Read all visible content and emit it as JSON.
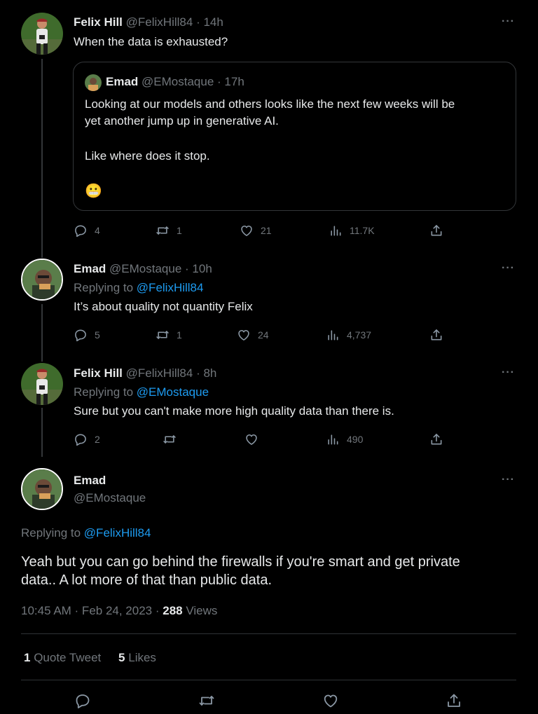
{
  "tweet1": {
    "name": "Felix Hill",
    "handle": "@FelixHill84",
    "time": "· 14h",
    "more": "···",
    "text": "When the data is exhausted?",
    "quote": {
      "name": "Emad",
      "handle": "@EMostaque",
      "time": "· 17h",
      "line1": "Looking at our models and others looks like the next few weeks will be",
      "line2": "yet another jump up in generative AI.",
      "line3": "Like where does it stop.",
      "emoji": "😬"
    },
    "replies": "4",
    "retweets": "1",
    "likes": "21",
    "views": "11.7K"
  },
  "tweet2": {
    "name": "Emad",
    "handle": "@EMostaque",
    "time": "· 10h",
    "more": "···",
    "replying_prefix": "Replying to",
    "replying_to": "@FelixHill84",
    "text": "It’s about quality not quantity Felix",
    "replies": "5",
    "retweets": "1",
    "likes": "24",
    "views": "4,737"
  },
  "tweet3": {
    "name": "Felix Hill",
    "handle": "@FelixHill84",
    "time": "· 8h",
    "more": "···",
    "replying_prefix": "Replying to",
    "replying_to": "@EMostaque",
    "text": "Sure but you can't make more high quality data than there is.",
    "replies": "2",
    "views": "490"
  },
  "main": {
    "name": "Emad",
    "handle": "@EMostaque",
    "more": "···",
    "replying_prefix": "Replying to",
    "replying_to": "@FelixHill84",
    "line1": "Yeah but you can go behind the firewalls if you're smart and get private",
    "line2": "data.. A lot more of that than public data.",
    "timestamp": "10:45 AM · Feb 24, 2023 ·",
    "views_count": "288",
    "views_label": "Views",
    "quote_count": "1",
    "quote_label": "Quote Tweet",
    "likes_count": "5",
    "likes_label": "Likes"
  },
  "colors": {
    "background": "#000000",
    "text": "#e7e9ea",
    "muted": "#71767b",
    "link": "#1d9bf0",
    "border": "#2f3336"
  },
  "icons": [
    "reply-icon",
    "retweet-icon",
    "like-icon",
    "views-icon",
    "share-icon",
    "more-icon"
  ]
}
